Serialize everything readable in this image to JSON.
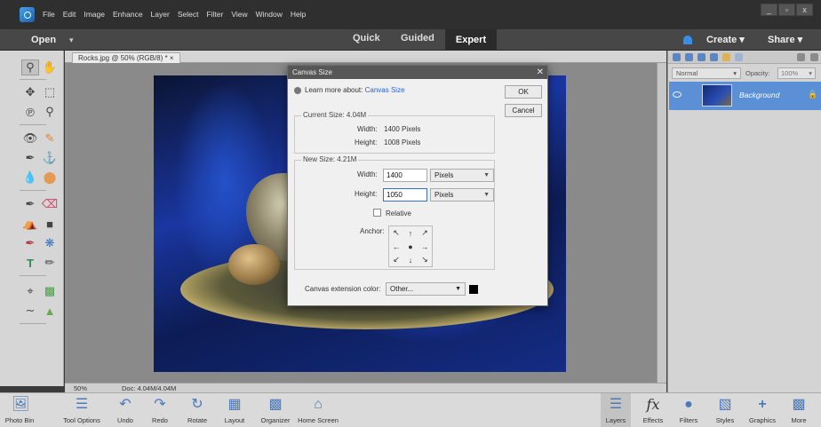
{
  "menubar": {
    "items": [
      "File",
      "Edit",
      "Image",
      "Enhance",
      "Layer",
      "Select",
      "Filter",
      "View",
      "Window",
      "Help"
    ],
    "window_buttons": [
      "_",
      "▫",
      "x"
    ]
  },
  "modebar": {
    "open_label": "Open",
    "modes": [
      "Quick",
      "Guided",
      "Expert"
    ],
    "create_label": "Create",
    "share_label": "Share"
  },
  "document": {
    "tab_label": "Rocks.jpg @ 50% (RGB/8) * ×",
    "zoom": "50%",
    "doc_size": "Doc: 4.04M/4.04M"
  },
  "layers_panel": {
    "blend_mode": "Normal",
    "opacity_label": "Opacity:",
    "opacity_value": "100%",
    "layer_name": "Background"
  },
  "dialog": {
    "title": "Canvas Size",
    "learn_prefix": "Learn more about:",
    "learn_link": "Canvas Size",
    "ok_label": "OK",
    "cancel_label": "Cancel",
    "current_size_label": "Current Size: 4.04M",
    "current_width_label": "Width:",
    "current_width_value": "1400 Pixels",
    "current_height_label": "Height:",
    "current_height_value": "1008 Pixels",
    "new_size_label": "New Size: 4.21M",
    "new_width_label": "Width:",
    "new_width_value": "1400",
    "new_width_unit": "Pixels",
    "new_height_label": "Height:",
    "new_height_value": "1050",
    "new_height_unit": "Pixels",
    "relative_label": "Relative",
    "anchor_label": "Anchor:",
    "extension_label": "Canvas extension color:",
    "extension_value": "Other...",
    "extension_swatch_color": "#000000"
  },
  "bottombar": {
    "items": [
      "Photo Bin",
      "Tool Options",
      "Undo",
      "Redo",
      "Rotate",
      "Layout",
      "Organizer",
      "Home Screen",
      "Layers",
      "Effects",
      "Filters",
      "Styles",
      "Graphics",
      "More"
    ]
  },
  "colors": {
    "expert_bg": "#2b2b2b",
    "layer_selected": "#5b8fd6",
    "link": "#2c63c8"
  }
}
